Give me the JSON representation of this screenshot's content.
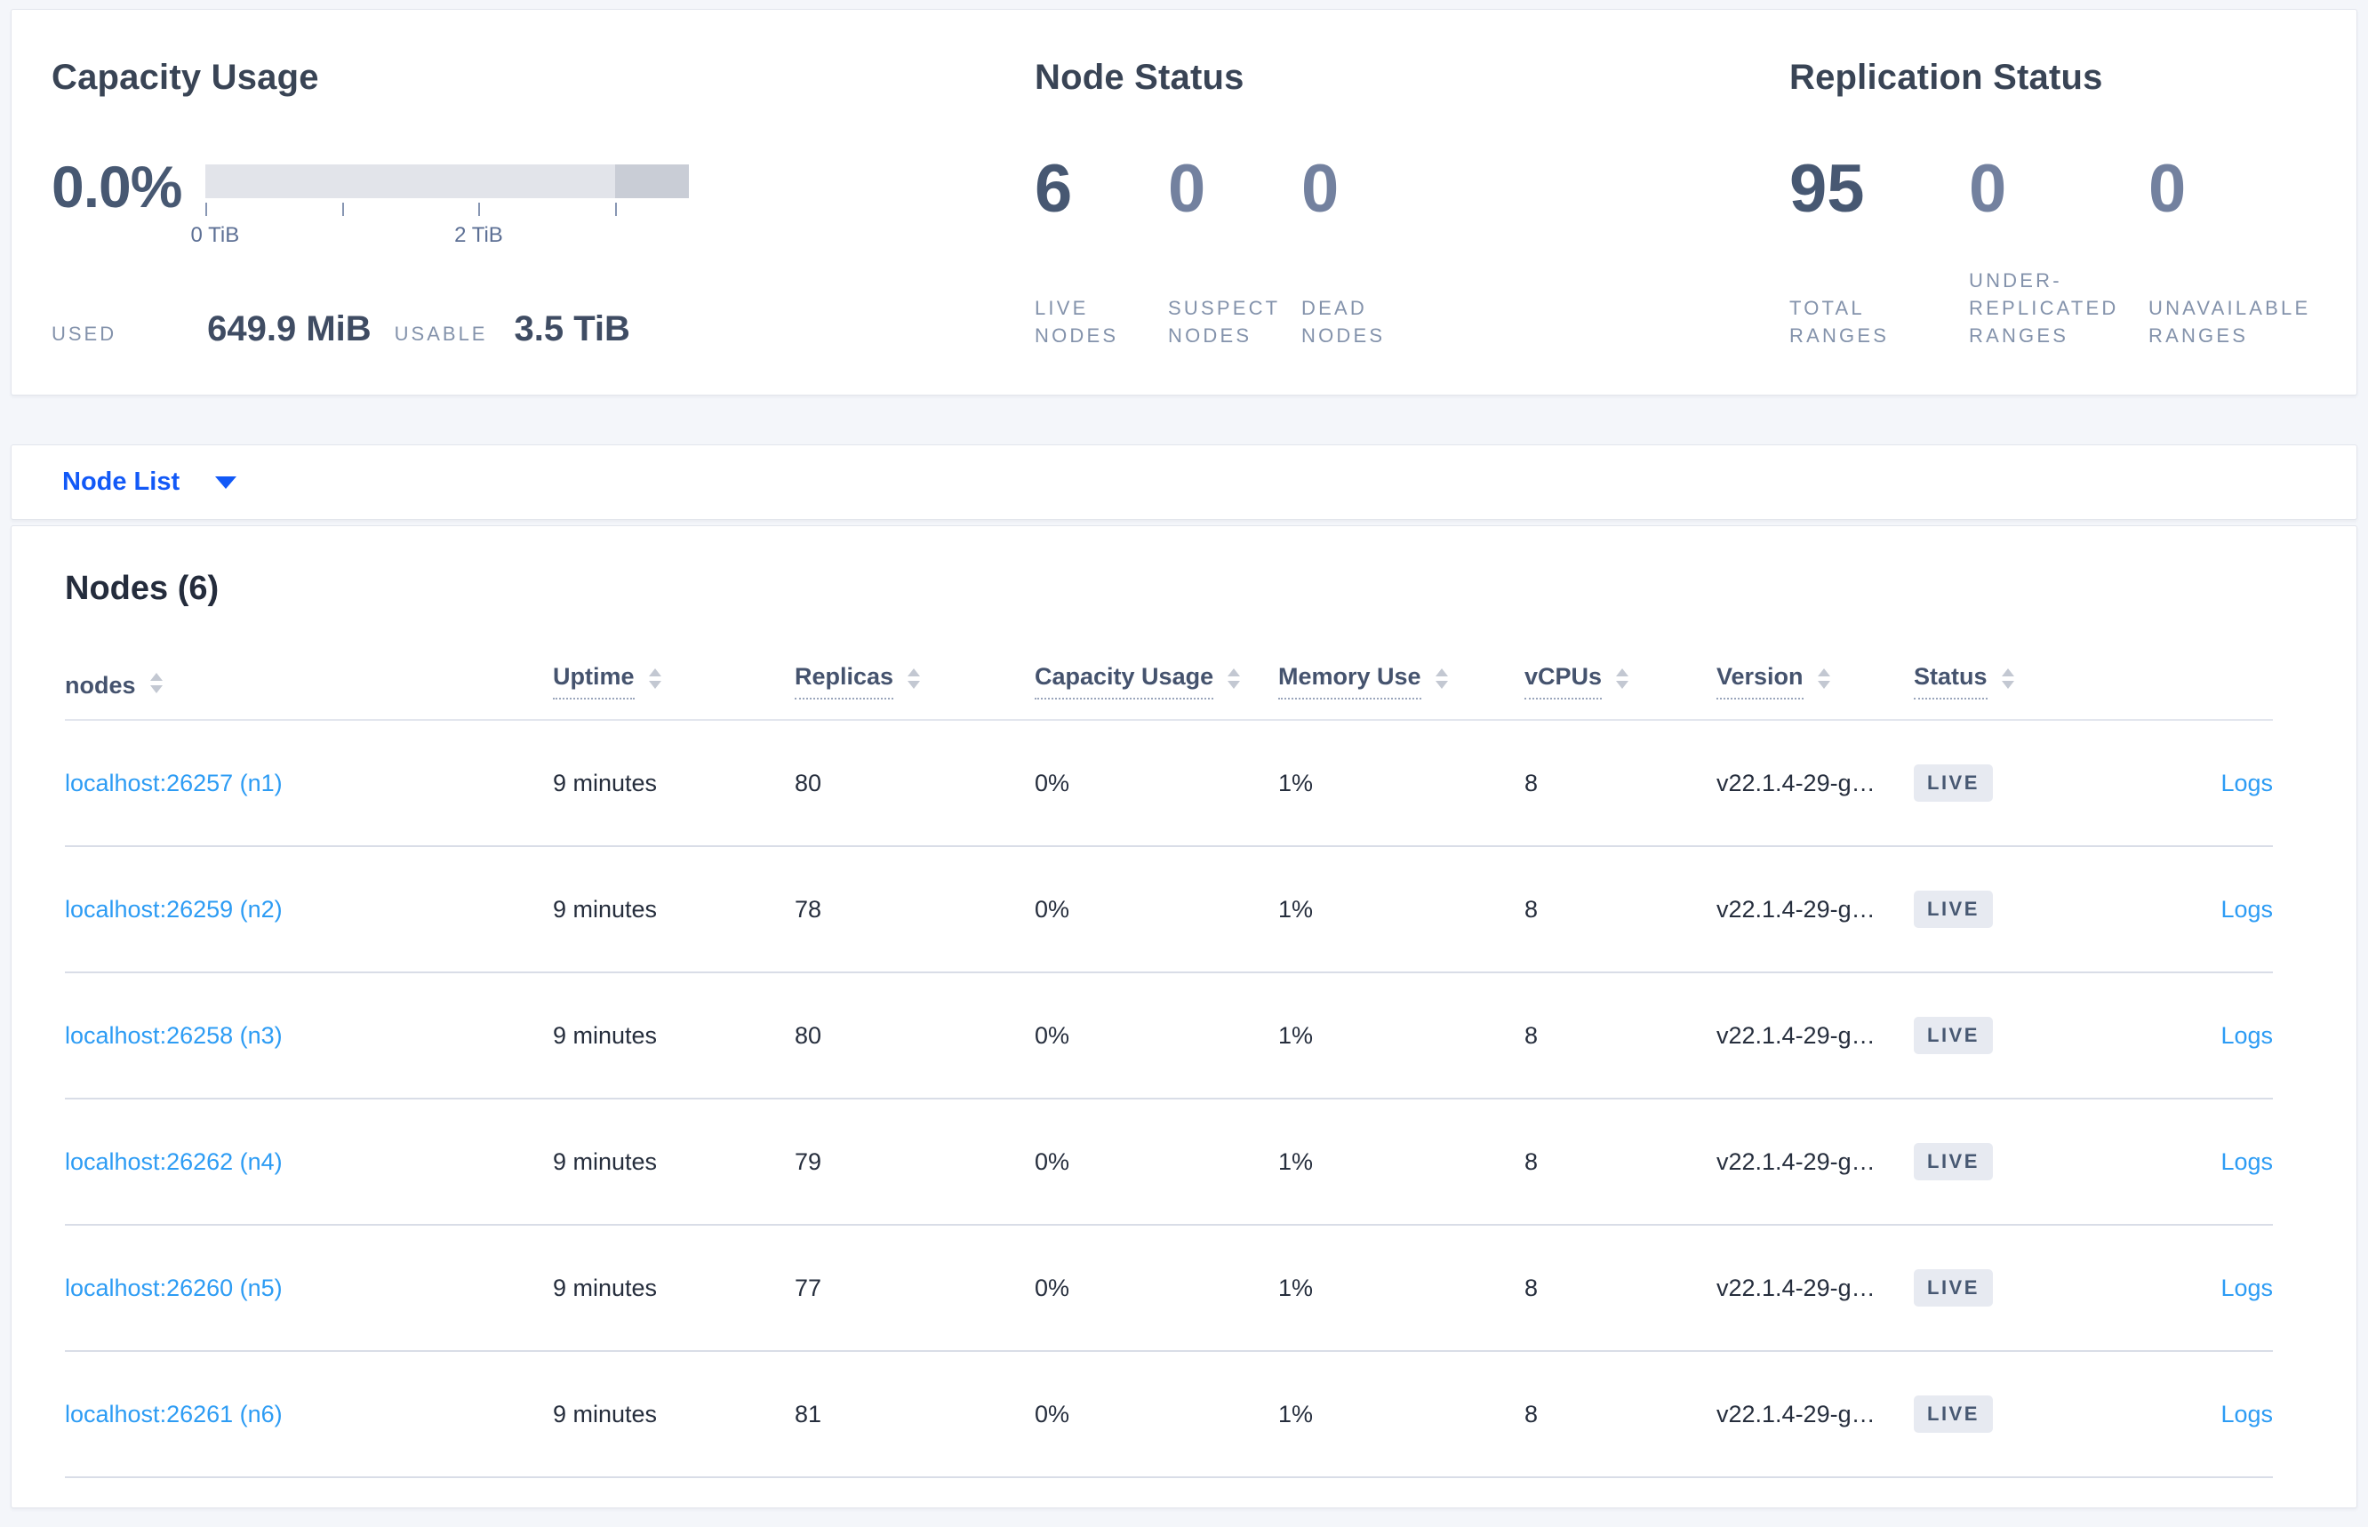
{
  "summary": {
    "capacity": {
      "title": "Capacity Usage",
      "percent": "0.0%",
      "tick_labels": [
        "0 TiB",
        "2 TiB"
      ],
      "used_label": "USED",
      "used_value": "649.9 MiB",
      "usable_label": "USABLE",
      "usable_value": "3.5 TiB"
    },
    "node_status": {
      "title": "Node Status",
      "stats": [
        {
          "value": "6",
          "label": "LIVE NODES"
        },
        {
          "value": "0",
          "label": "SUSPECT NODES"
        },
        {
          "value": "0",
          "label": "DEAD NODES"
        }
      ]
    },
    "replication": {
      "title": "Replication Status",
      "stats": [
        {
          "value": "95",
          "label": "TOTAL RANGES"
        },
        {
          "value": "0",
          "label": "UNDER-REPLICATED RANGES"
        },
        {
          "value": "0",
          "label": "UNAVAILABLE RANGES"
        }
      ]
    }
  },
  "view_selector": {
    "label": "Node List",
    "icon": "caret-down-icon"
  },
  "nodes_section": {
    "title": "Nodes (6)",
    "columns": [
      {
        "label": "nodes",
        "sortable": true,
        "tooltip": false
      },
      {
        "label": "Uptime",
        "sortable": true,
        "tooltip": true
      },
      {
        "label": "Replicas",
        "sortable": true,
        "tooltip": true
      },
      {
        "label": "Capacity Usage",
        "sortable": true,
        "tooltip": true
      },
      {
        "label": "Memory Use",
        "sortable": true,
        "tooltip": true
      },
      {
        "label": "vCPUs",
        "sortable": true,
        "tooltip": true
      },
      {
        "label": "Version",
        "sortable": true,
        "tooltip": true
      },
      {
        "label": "Status",
        "sortable": true,
        "tooltip": true
      },
      {
        "label": "",
        "sortable": false,
        "tooltip": false
      }
    ],
    "rows": [
      {
        "name": "localhost:26257 (n1)",
        "uptime": "9 minutes",
        "replicas": "80",
        "capacity_usage": "0%",
        "memory_use": "1%",
        "vcpus": "8",
        "version": "v22.1.4-29-g…",
        "status": "LIVE",
        "logs_label": "Logs"
      },
      {
        "name": "localhost:26259 (n2)",
        "uptime": "9 minutes",
        "replicas": "78",
        "capacity_usage": "0%",
        "memory_use": "1%",
        "vcpus": "8",
        "version": "v22.1.4-29-g…",
        "status": "LIVE",
        "logs_label": "Logs"
      },
      {
        "name": "localhost:26258 (n3)",
        "uptime": "9 minutes",
        "replicas": "80",
        "capacity_usage": "0%",
        "memory_use": "1%",
        "vcpus": "8",
        "version": "v22.1.4-29-g…",
        "status": "LIVE",
        "logs_label": "Logs"
      },
      {
        "name": "localhost:26262 (n4)",
        "uptime": "9 minutes",
        "replicas": "79",
        "capacity_usage": "0%",
        "memory_use": "1%",
        "vcpus": "8",
        "version": "v22.1.4-29-g…",
        "status": "LIVE",
        "logs_label": "Logs"
      },
      {
        "name": "localhost:26260 (n5)",
        "uptime": "9 minutes",
        "replicas": "77",
        "capacity_usage": "0%",
        "memory_use": "1%",
        "vcpus": "8",
        "version": "v22.1.4-29-g…",
        "status": "LIVE",
        "logs_label": "Logs"
      },
      {
        "name": "localhost:26261 (n6)",
        "uptime": "9 minutes",
        "replicas": "81",
        "capacity_usage": "0%",
        "memory_use": "1%",
        "vcpus": "8",
        "version": "v22.1.4-29-g…",
        "status": "LIVE",
        "logs_label": "Logs"
      }
    ]
  },
  "colors": {
    "selector_blue": "#1259f7",
    "link_blue": "#2d9cf4",
    "badge_bg": "#e7eaf1",
    "badge_text": "#475872",
    "bar_light": "#e2e4ea",
    "bar_dark": "#c9cdd6"
  }
}
